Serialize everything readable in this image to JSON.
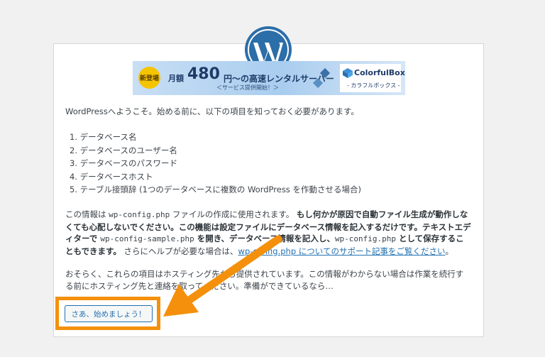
{
  "banner": {
    "badge": "新登場",
    "month": "月額",
    "price": "480",
    "tail": "円〜の高速レンタルサーバー",
    "sub": "＜サービス提供開始！＞",
    "brand_name": "ColorfulBox",
    "brand_sub": "- カラフルボックス -"
  },
  "intro": "WordPressへようこそ。始める前に、以下の項目を知っておく必要があります。",
  "requirements": [
    "1. データベース名",
    "2. データベースのユーザー名",
    "3. データベースのパスワード",
    "4. データベースホスト",
    "5. テーブル接頭辞 (1つのデータベースに複数の WordPress を作動させる場合)"
  ],
  "info": {
    "t1": "この情報は ",
    "code1": "wp-config.php",
    "t2": " ファイルの作成に使用されます。 ",
    "b1": "もし何かが原因で自動ファイル生成が動作しなくても心配しないでください。この機能は設定ファイルにデータベース情報を記入するだけです。テキストエディターで ",
    "code2": "wp-config-sample.php",
    "b2": " を開き、データベース情報を記入し、",
    "code3": "wp-config.php",
    "b3": " として保存することもできます。",
    "t3": " さらにヘルプが必要な場合は、",
    "link": "wp-config.php についてのサポート記事をご覧ください",
    "t4": "。"
  },
  "hosting_note": "おそらく、これらの項目はホスティング先から提供されています。この情報がわからない場合は作業を続行する前にホスティング先と連絡を取ってください。準備ができているなら…",
  "start_button": "さあ、始めましょう！",
  "colors": {
    "accent": "#2271b1",
    "highlight": "#f4900c",
    "wp_blue": "#2c6ea8"
  }
}
